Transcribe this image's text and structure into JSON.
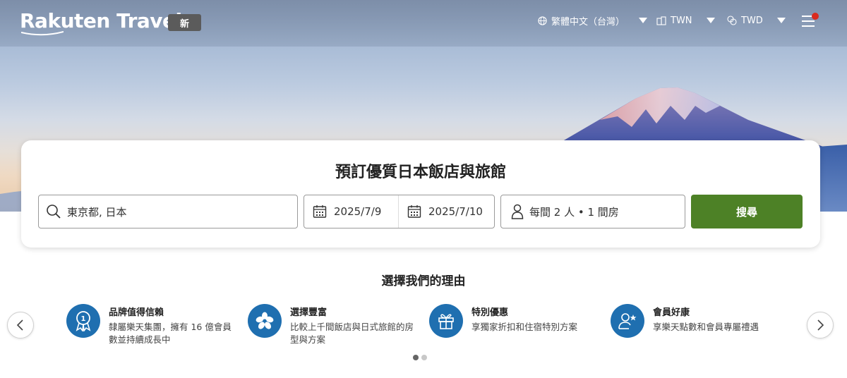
{
  "header": {
    "logo_text": "Rakuten Travel",
    "new_badge": "新",
    "language": "繁體中文（台灣）",
    "region": "TWN",
    "currency": "TWD"
  },
  "search": {
    "title": "預訂優質日本飯店與旅館",
    "destination": "東京都, 日本",
    "checkin": "2025/7/9",
    "checkout": "2025/7/10",
    "guests": "每間 2 人 • 1 間房",
    "button": "搜尋"
  },
  "reasons": {
    "title": "選擇我們的理由",
    "items": [
      {
        "title": "品牌值得信賴",
        "desc": "隸屬樂天集團，擁有 16 億會員數並持續成長中",
        "icon": "award-medal-icon"
      },
      {
        "title": "選擇豐富",
        "desc": "比較上千間飯店與日式旅館的房型與方案",
        "icon": "flower-icon"
      },
      {
        "title": "特別優惠",
        "desc": "享獨家折扣和住宿特別方案",
        "icon": "gift-icon"
      },
      {
        "title": "會員好康",
        "desc": "享樂天點數和會員專屬禮遇",
        "icon": "member-star-icon"
      }
    ]
  },
  "colors": {
    "search_button": "#4d8126",
    "feature_icon_bg": "#1f6fb0",
    "notification_dot": "#d92b1f"
  }
}
